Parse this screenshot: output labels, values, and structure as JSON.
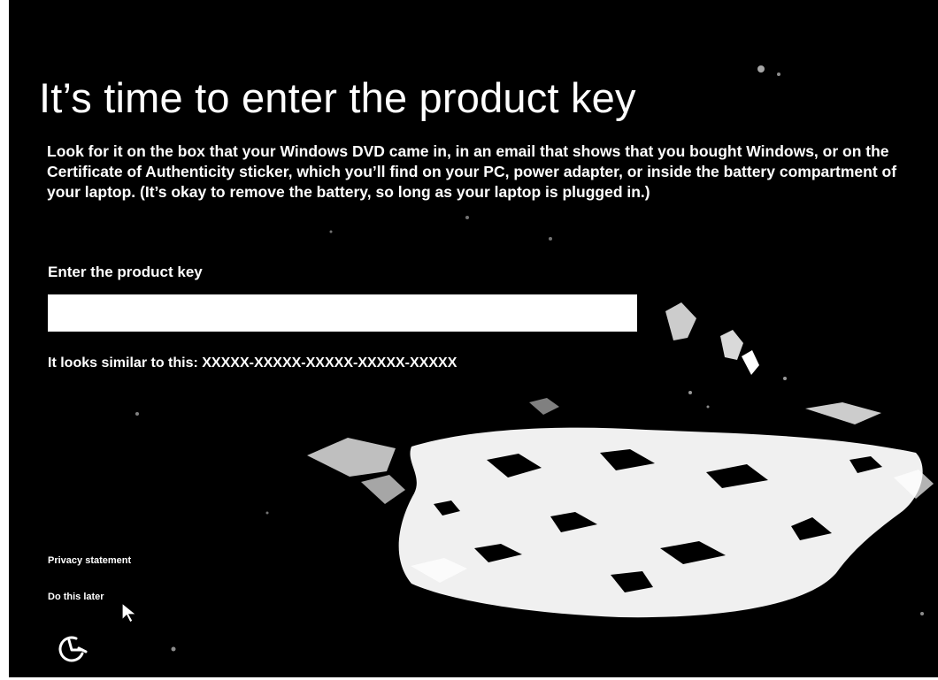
{
  "setup": {
    "title": "It’s time to enter the product key",
    "description": "Look for it on the box that your Windows DVD came in, in an email that shows that you bought Windows, or on the Certificate of Authenticity sticker, which you’ll find on your PC, power adapter, or inside the battery compartment of your laptop. (It’s okay to remove the battery, so long as your laptop is plugged in.)",
    "field_label": "Enter the product key",
    "field_value": "",
    "hint": "It looks similar to this: XXXXX-XXXXX-XXXXX-XXXXX-XXXXX"
  },
  "footer": {
    "privacy_label": "Privacy statement",
    "later_label": "Do this later"
  },
  "icons": {
    "ease_of_access": "ease-of-access-icon",
    "cursor": "mouse-pointer-icon"
  },
  "colors": {
    "background": "#000000",
    "text": "#ffffff",
    "input_background": "#ffffff"
  }
}
